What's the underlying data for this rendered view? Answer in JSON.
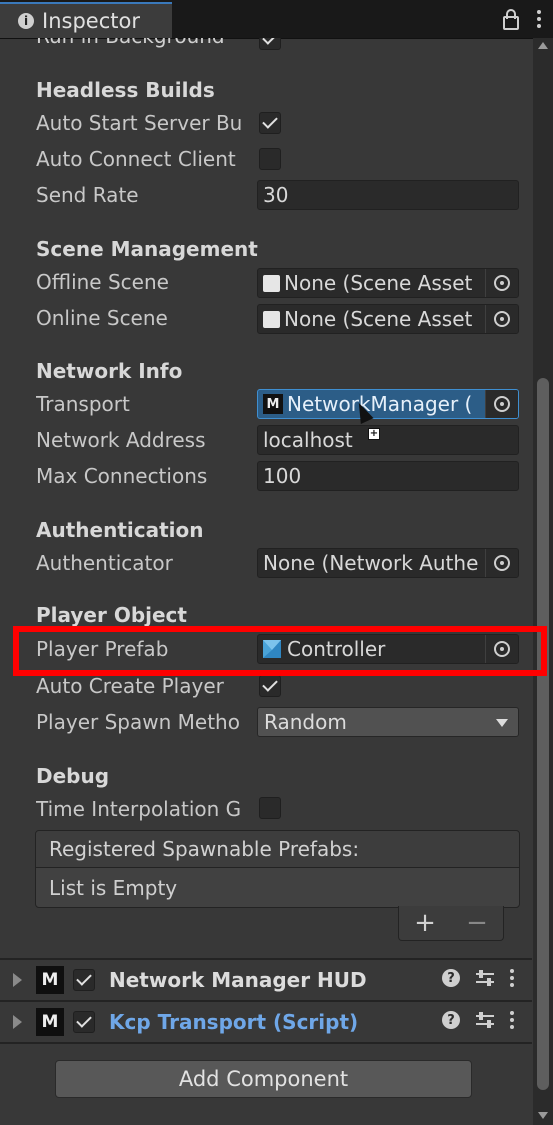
{
  "tab": {
    "title": "Inspector"
  },
  "partial_row": {
    "label": "Run in Background"
  },
  "headless": {
    "title": "Headless Builds",
    "auto_start_label": "Auto Start Server Bu",
    "auto_connect_label": "Auto Connect Client",
    "send_rate_label": "Send Rate",
    "send_rate_value": "30"
  },
  "scene": {
    "title": "Scene Management",
    "offline_label": "Offline Scene",
    "offline_value": "None (Scene Asset",
    "online_label": "Online Scene",
    "online_value": "None (Scene Asset"
  },
  "network": {
    "title": "Network Info",
    "transport_label": "Transport",
    "transport_value": "NetworkManager (",
    "address_label": "Network Address",
    "address_value": "localhost",
    "maxconn_label": "Max Connections",
    "maxconn_value": "100"
  },
  "auth": {
    "title": "Authentication",
    "authenticator_label": "Authenticator",
    "authenticator_value": "None (Network Authe"
  },
  "player": {
    "title": "Player Object",
    "prefab_label": "Player Prefab",
    "prefab_value": "Controller",
    "auto_create_label": "Auto Create Player",
    "spawn_label": "Player Spawn Metho",
    "spawn_value": "Random"
  },
  "debug": {
    "title": "Debug",
    "time_interp_label": "Time Interpolation G"
  },
  "spawnables": {
    "header": "Registered Spawnable Prefabs:",
    "empty": "List is Empty",
    "add": "+",
    "remove": "−"
  },
  "components": [
    {
      "title": "Network Manager HUD"
    },
    {
      "title": "Kcp Transport (Script)"
    }
  ],
  "add_component": "Add Component",
  "colors": {
    "accent": "#3a79bb",
    "highlight": "#ff0000",
    "selected": "#2c5d87",
    "link": "#6fa7e8"
  }
}
